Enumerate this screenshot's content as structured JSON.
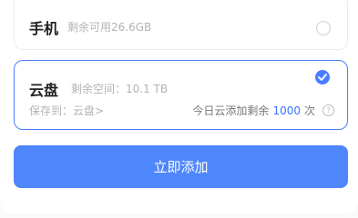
{
  "phone": {
    "title": "手机",
    "remaining": "剩余可用26.6GB"
  },
  "cloud": {
    "title": "云盘",
    "space": "剩余空间：10.1 TB",
    "save_to": "保存到：云盘>",
    "quota_prefix": "今日云添加剩余",
    "quota_count": "1000",
    "quota_suffix": "次"
  },
  "action": {
    "label": "立即添加"
  },
  "colors": {
    "accent": "#4e86fb",
    "selected_border": "#4a7dff"
  }
}
